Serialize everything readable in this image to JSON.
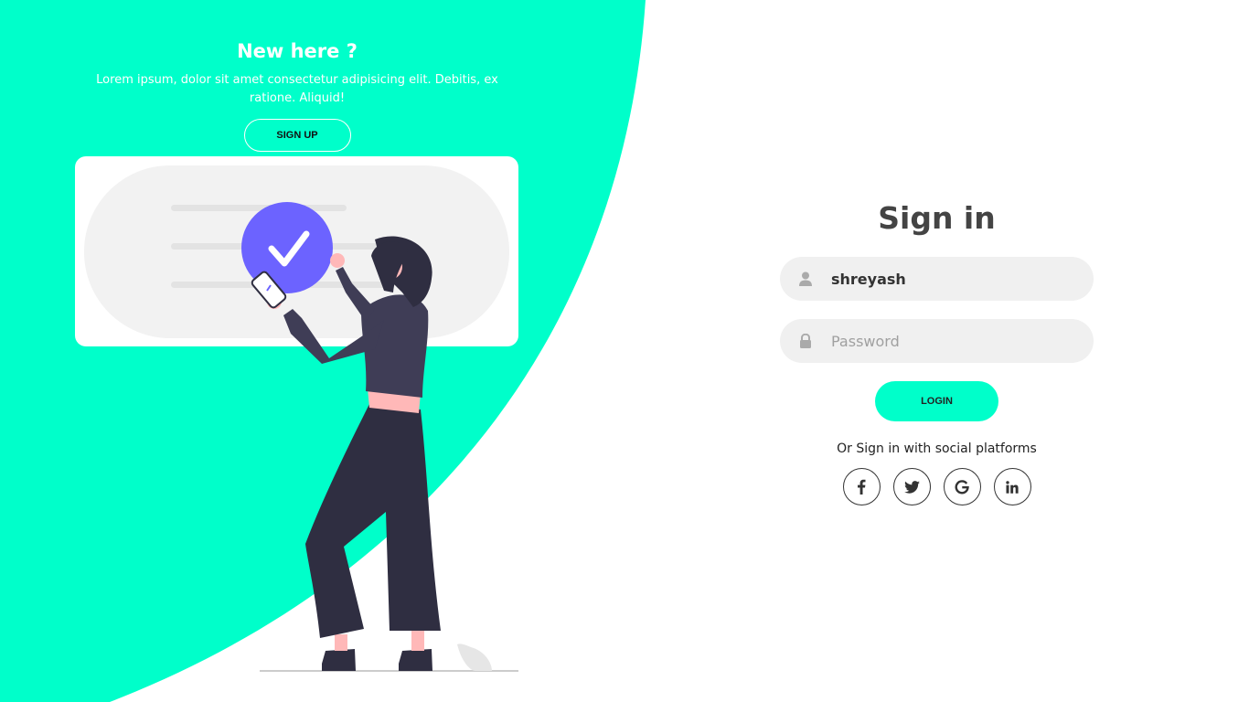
{
  "colors": {
    "accent": "#00ffca",
    "check_circle": "#6c63ff",
    "text_dark": "#444444"
  },
  "left_panel": {
    "title": "New here ?",
    "description": "Lorem ipsum, dolor sit amet consectetur adipisicing elit. Debitis, ex ratione. Aliquid!",
    "signup_label": "SIGN UP"
  },
  "sign_in": {
    "title": "Sign in",
    "username": {
      "value": "shreyash",
      "icon": "user-icon"
    },
    "password": {
      "placeholder": "Password",
      "icon": "lock-icon"
    },
    "login_label": "LOGIN",
    "social_text": "Or Sign in with social platforms",
    "social": [
      {
        "name": "facebook",
        "icon": "facebook-icon"
      },
      {
        "name": "twitter",
        "icon": "twitter-icon"
      },
      {
        "name": "google",
        "icon": "google-icon"
      },
      {
        "name": "linkedin",
        "icon": "linkedin-icon"
      }
    ]
  }
}
